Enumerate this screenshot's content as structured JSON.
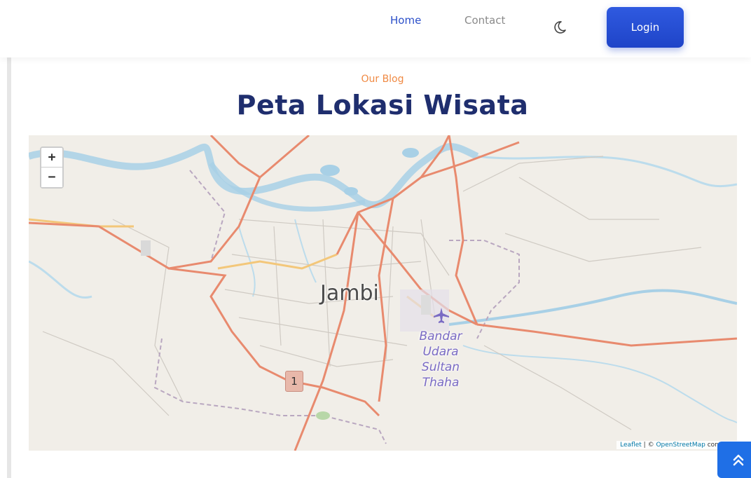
{
  "navbar": {
    "links": [
      {
        "label": "Home",
        "active": true
      },
      {
        "label": "Contact",
        "active": false
      }
    ],
    "theme_icon": "moon-icon",
    "login_label": "Login",
    "accent_color": "#2b4fc9"
  },
  "header": {
    "eyebrow": "Our Blog",
    "title": "Peta Lokasi Wisata",
    "eyebrow_color": "#f08a44",
    "title_color": "#1f2e6e"
  },
  "map": {
    "zoom_in_label": "+",
    "zoom_out_label": "−",
    "city_label": "Jambi",
    "airport_label": [
      "Bandar",
      "Udara",
      "Sultan",
      "Thaha"
    ],
    "airport_icon": "airplane-icon",
    "road_number": "1",
    "attribution": {
      "leaflet": "Leaflet",
      "separator": " | © ",
      "osm": "OpenStreetMap",
      "suffix": " contribu"
    },
    "colors": {
      "land": "#f1eee8",
      "river": "#a8d0e6",
      "main_road": "#e88a6e",
      "secondary_road": "#f3c77a",
      "boundary": "#b9a7c0"
    }
  },
  "back_to_top_icon": "double-chevron-up-icon"
}
